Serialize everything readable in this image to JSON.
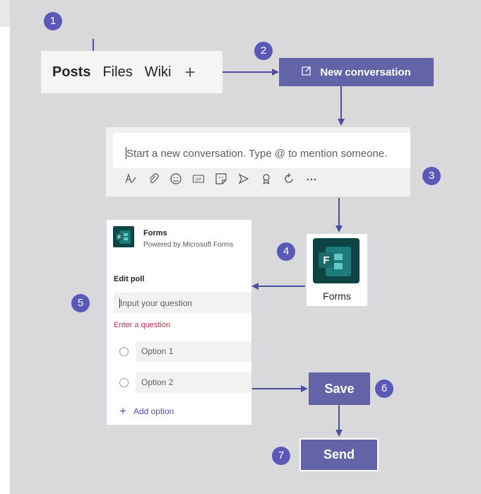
{
  "steps": [
    "1",
    "2",
    "3",
    "4",
    "5",
    "6",
    "7"
  ],
  "tabs": {
    "posts": "Posts",
    "files": "Files",
    "wiki": "Wiki",
    "add": "+"
  },
  "new_conversation": {
    "label": "New conversation",
    "icon": "compose-icon"
  },
  "composer": {
    "placeholder": "Start a new conversation. Type @ to mention someone.",
    "toolbar_icons": [
      "format-icon",
      "attach-icon",
      "emoji-icon",
      "gif-icon",
      "sticker-icon",
      "meet-icon",
      "praise-icon",
      "loop-icon",
      "more-icon"
    ]
  },
  "forms_app": {
    "label": "Forms",
    "icon": "forms-icon"
  },
  "poll": {
    "app_name": "Forms",
    "app_sub": "Powered by Microsoft Forms",
    "heading": "Edit poll",
    "question_placeholder": "Input your question",
    "error": "Enter a question",
    "options": [
      "Option 1",
      "Option 2"
    ],
    "add_option": "Add option"
  },
  "buttons": {
    "save": "Save",
    "send": "Send"
  },
  "colors": {
    "accent": "#6264a7",
    "badge": "#5a59b8",
    "arrow": "#4a4fa0",
    "forms": "#0f4445",
    "error": "#c4314b"
  }
}
